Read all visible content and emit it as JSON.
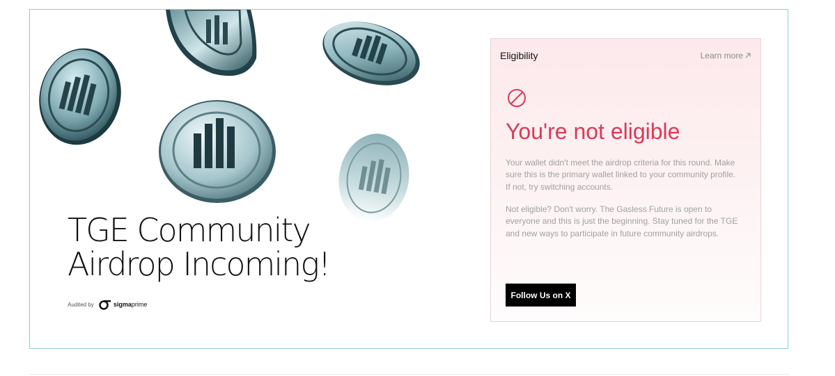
{
  "hero": {
    "title_line1": "TGE Community",
    "title_line2": "Airdrop Incoming!",
    "audited_label": "Audited by",
    "auditor_name_bold": "sigma",
    "auditor_name_light": "prime"
  },
  "eligibility": {
    "title": "Eligibility",
    "learn_more": "Learn more",
    "status_heading": "You're not eligible",
    "paragraph1": "Your wallet didn't meet the airdrop criteria for this round. Make sure this is the primary wallet linked to your community profile. If not, try switching accounts.",
    "paragraph2": "Not eligible? Don't worry. The Gasless Future is open to everyone and this is just the beginning. Stay tuned for the TGE and new ways to participate in future community airdrops.",
    "follow_button": "Follow Us on X",
    "status_icon": "ban-icon",
    "accent_color": "#d93a57"
  },
  "icons": {
    "learn_more": "arrow-up-right-icon",
    "coin": "coin-logo-icon"
  }
}
